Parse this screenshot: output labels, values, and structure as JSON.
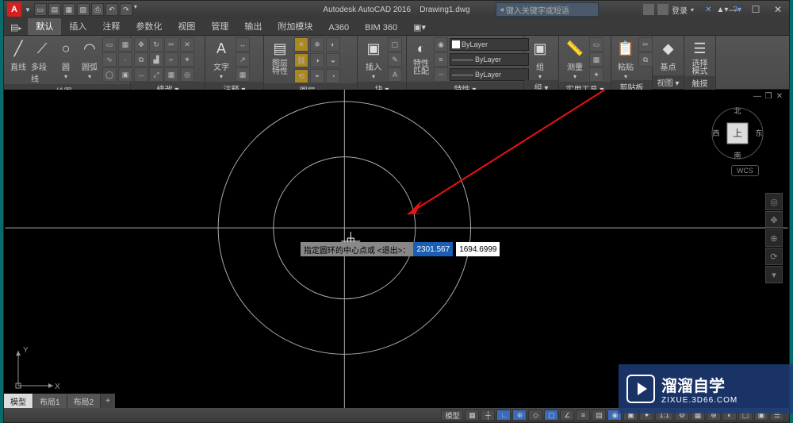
{
  "app": {
    "name": "A",
    "title": "Autodesk AutoCAD 2016",
    "file": "Drawing1.dwg",
    "search_placeholder": "键入关键字或短语",
    "login": "登录"
  },
  "win": {
    "min": "—",
    "max": "☐",
    "close": "✕"
  },
  "tabs": {
    "file": "",
    "items": [
      "默认",
      "插入",
      "注释",
      "参数化",
      "视图",
      "管理",
      "输出",
      "附加模块",
      "A360",
      "BIM 360"
    ],
    "active": 0,
    "plugin": "▣▾"
  },
  "ribbon": {
    "draw": {
      "label": "绘图 ▾",
      "line": "直线",
      "polyline": "多段线",
      "circle": "圆",
      "arc": "圆弧"
    },
    "modify": {
      "label": "修改 ▾"
    },
    "annotation": {
      "label": "注释 ▾",
      "text": "文字"
    },
    "layers": {
      "label": "图层 ▾",
      "props": "图层\n特性"
    },
    "block": {
      "label": "块 ▾",
      "insert": "插入"
    },
    "properties": {
      "label": "特性 ▾",
      "match": "特性\n匹配",
      "bylayer": "ByLayer"
    },
    "group": {
      "label": "组 ▾",
      "group": "组"
    },
    "utilities": {
      "label": "实用工具 ▾",
      "measure": "测量"
    },
    "clipboard": {
      "label": "剪贴板",
      "paste": "粘贴"
    },
    "view": {
      "label": "视图 ▾",
      "base": "基点"
    },
    "touch": {
      "label": "触摸",
      "mode": "选择\n模式"
    }
  },
  "canvas": {
    "prompt": "指定圆环的中心点或 <退出>：",
    "coord_x": "2301.567",
    "coord_y": "1694.6999",
    "viewcube": {
      "n": "北",
      "s": "南",
      "e": "东",
      "w": "西",
      "top": "上"
    },
    "wcs": "WCS",
    "ucs": {
      "x": "X",
      "y": "Y"
    }
  },
  "layouts": {
    "model": "模型",
    "layout1": "布局1",
    "layout2": "布局2",
    "plus": "+"
  },
  "status": {
    "model": "模型",
    "scale": "1:1"
  },
  "watermark": {
    "title": "溜溜自学",
    "url": "ZIXUE.3D66.COM"
  }
}
